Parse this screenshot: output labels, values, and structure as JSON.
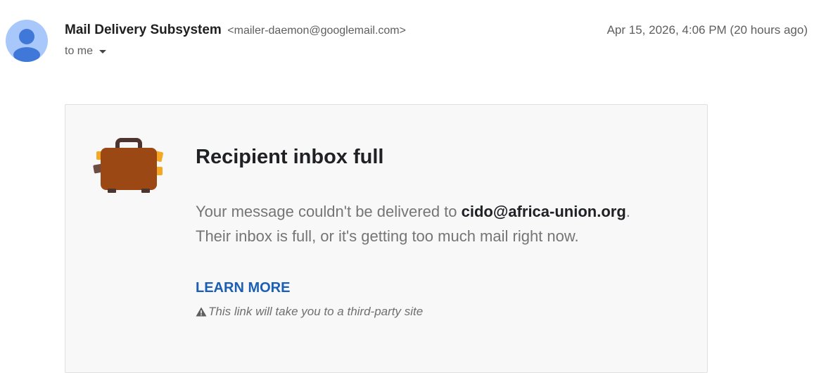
{
  "header": {
    "sender_name": "Mail Delivery Subsystem",
    "sender_email": "<mailer-daemon@googlemail.com>",
    "recipient_label": "to me",
    "date": "Apr 15, 2026, 4:06 PM (20 hours ago)"
  },
  "avatar": {
    "icon": "person-icon",
    "background_color": "#a8c7fa",
    "figure_color": "#3f78d9"
  },
  "card": {
    "icon": "briefcase-icon",
    "title": "Recipient inbox full",
    "body_prefix": "Your message couldn't be delivered to ",
    "recipient_address": "cido@africa-union.org",
    "body_suffix": ".",
    "body_line2": "Their inbox is full, or it's getting too much mail right now.",
    "learn_more_label": "LEARN MORE",
    "learn_more_color": "#1a5fb4",
    "warning_icon": "warning-triangle-icon",
    "third_party_note": "This link will take you to a third-party site"
  }
}
